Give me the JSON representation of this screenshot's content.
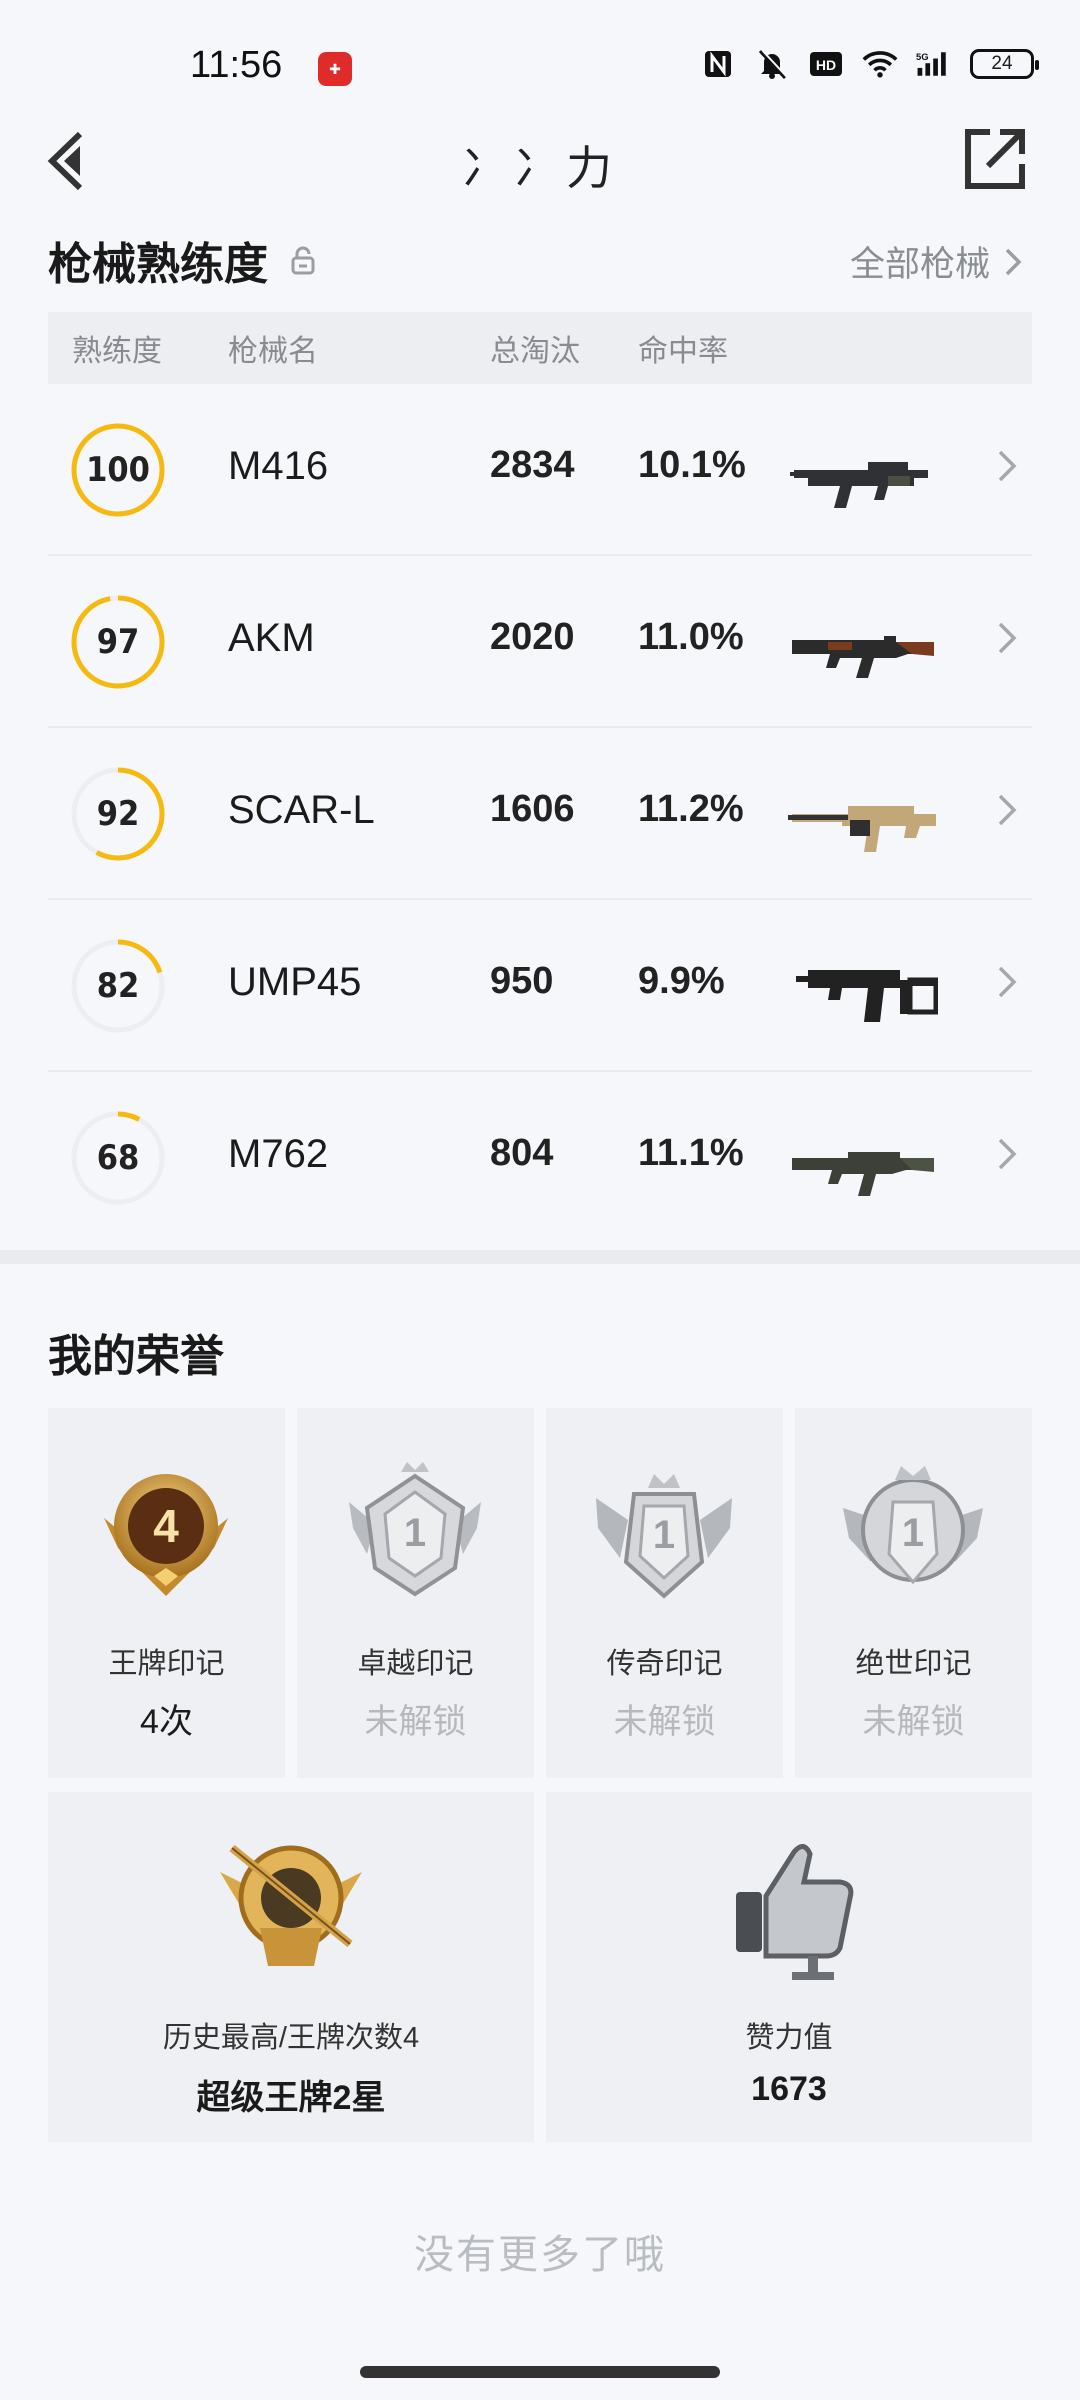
{
  "status": {
    "time": "11:56",
    "battery": "24",
    "icons": [
      "nfc-icon",
      "mute-icon",
      "hd-icon",
      "wifi-icon",
      "5g-signal-icon",
      "battery-icon"
    ]
  },
  "nav": {
    "title": "冫冫力"
  },
  "proficiency": {
    "title": "枪械熟练度",
    "all_link": "全部枪械",
    "headers": {
      "level": "熟练度",
      "name": "枪械名",
      "kills": "总淘汰",
      "hit_rate": "命中率"
    },
    "rows": [
      {
        "level": "100",
        "progress": 1.0,
        "name": "M416",
        "kills": "2834",
        "hit_rate": "10.1%",
        "icon": "m416-rifle-icon"
      },
      {
        "level": "97",
        "progress": 0.97,
        "name": "AKM",
        "kills": "2020",
        "hit_rate": "11.0%",
        "icon": "akm-rifle-icon"
      },
      {
        "level": "92",
        "progress": 0.58,
        "name": "SCAR-L",
        "kills": "1606",
        "hit_rate": "11.2%",
        "icon": "scar-rifle-icon"
      },
      {
        "level": "82",
        "progress": 0.2,
        "name": "UMP45",
        "kills": "950",
        "hit_rate": "9.9%",
        "icon": "ump45-smg-icon"
      },
      {
        "level": "68",
        "progress": 0.08,
        "name": "M762",
        "kills": "804",
        "hit_rate": "11.1%",
        "icon": "m762-rifle-icon"
      }
    ],
    "ring_color": "#f5b90f"
  },
  "honors": {
    "title": "我的荣誉",
    "marks": [
      {
        "label": "王牌印记",
        "value": "4次",
        "locked": false,
        "badge_number": "4"
      },
      {
        "label": "卓越印记",
        "value": "未解锁",
        "locked": true,
        "badge_number": "1"
      },
      {
        "label": "传奇印记",
        "value": "未解锁",
        "locked": true,
        "badge_number": "1"
      },
      {
        "label": "绝世印记",
        "value": "未解锁",
        "locked": true,
        "badge_number": "1"
      }
    ],
    "highest": {
      "label": "历史最高/王牌次数4",
      "value": "超级王牌2星"
    },
    "likes": {
      "label": "赞力值",
      "value": "1673"
    }
  },
  "footer": {
    "no_more": "没有更多了哦"
  }
}
